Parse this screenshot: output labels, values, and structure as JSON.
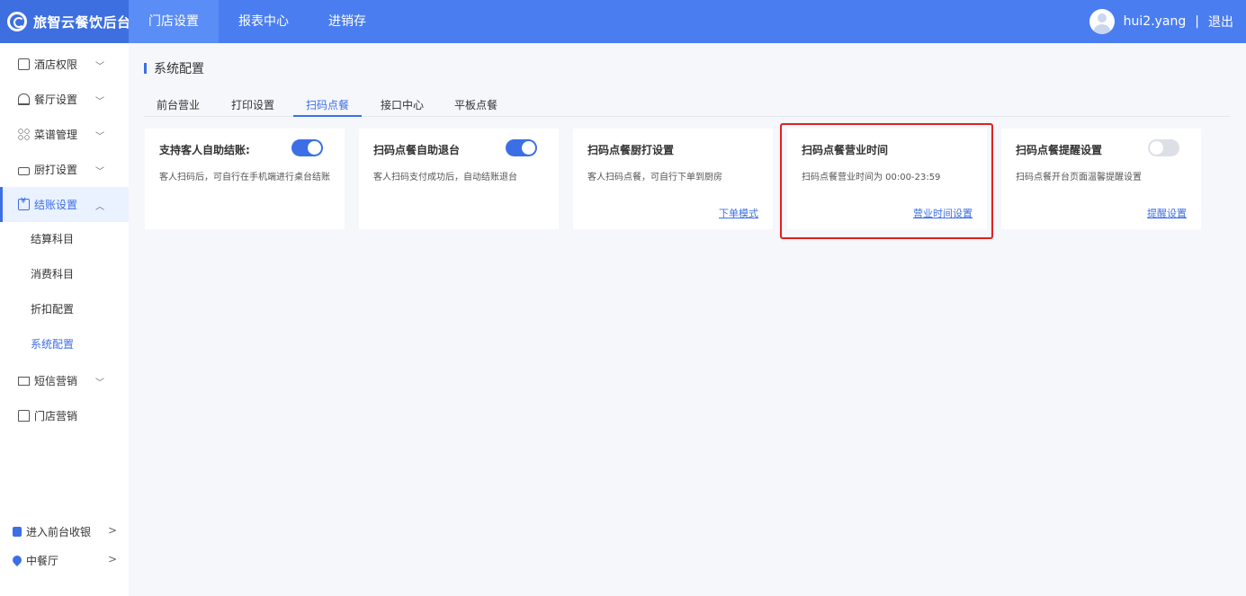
{
  "brand": {
    "name": "旅智云餐饮后台"
  },
  "topnav": [
    "门店设置",
    "报表中心",
    "进销存"
  ],
  "user": {
    "name": "hui2.yang",
    "separator": "|",
    "logout": "退出"
  },
  "sidebar": {
    "items": [
      {
        "label": "酒店权限",
        "icon": "hotel-icon"
      },
      {
        "label": "餐厅设置",
        "icon": "bell-icon"
      },
      {
        "label": "菜谱管理",
        "icon": "grid-icon"
      },
      {
        "label": "厨打设置",
        "icon": "printer-icon"
      },
      {
        "label": "结账设置",
        "icon": "bill-icon"
      }
    ],
    "subitems": [
      "结算科目",
      "消费科目",
      "折扣配置",
      "系统配置"
    ],
    "items2": [
      {
        "label": "短信营销",
        "icon": "mail-icon"
      },
      {
        "label": "门店营销",
        "icon": "store-icon"
      }
    ],
    "bottom": [
      {
        "label": "进入前台收银",
        "icon": "cashier-icon"
      },
      {
        "label": "中餐厅",
        "icon": "location-icon"
      }
    ]
  },
  "page": {
    "title": "系统配置"
  },
  "tabs": [
    "前台营业",
    "打印设置",
    "扫码点餐",
    "接口中心",
    "平板点餐"
  ],
  "cards": [
    {
      "title": "支持客人自助结账:",
      "desc": "客人扫码后，可自行在手机端进行桌台结账",
      "switch": "on",
      "link": ""
    },
    {
      "title": "扫码点餐自助退台",
      "desc": "客人扫码支付成功后，自动结账退台",
      "switch": "on",
      "link": ""
    },
    {
      "title": "扫码点餐厨打设置",
      "desc": "客人扫码点餐，可自行下单到厨房",
      "switch": "",
      "link": "下单模式"
    },
    {
      "title": "扫码点餐营业时间",
      "desc": "扫码点餐营业时间为 00:00-23:59",
      "switch": "",
      "link": "营业时间设置"
    },
    {
      "title": "扫码点餐提醒设置",
      "desc": "扫码点餐开台页面温馨提醒设置",
      "switch": "off",
      "link": "提醒设置"
    }
  ],
  "colors": {
    "primary": "#3c6fe6",
    "topbar": "#4a7ef0",
    "highlight": "#e02020"
  }
}
